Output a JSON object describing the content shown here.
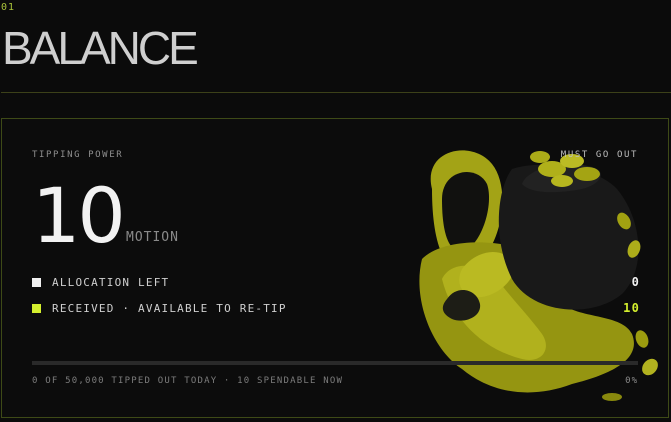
{
  "section": {
    "index": "01",
    "title": "BALANCE"
  },
  "card": {
    "label": "TIPPING POWER",
    "notice": "MUST GO OUT",
    "amount": "10",
    "unit": "MOTION",
    "rows": [
      {
        "label": "ALLOCATION LEFT",
        "value": "0",
        "color": "#f0f0f0"
      },
      {
        "label": "RECEIVED · AVAILABLE TO RE-TIP",
        "value": "10",
        "color": "#d4ef2e"
      }
    ],
    "progress": {
      "fraction": 0,
      "color": "#cfe83a"
    },
    "footer": "0 OF 50,000 TIPPED OUT TODAY · 10 SPENDABLE NOW",
    "percent": "0%",
    "mascot_icon": "money-sack-ghost-illustration",
    "accent": "#d4ef2e"
  }
}
